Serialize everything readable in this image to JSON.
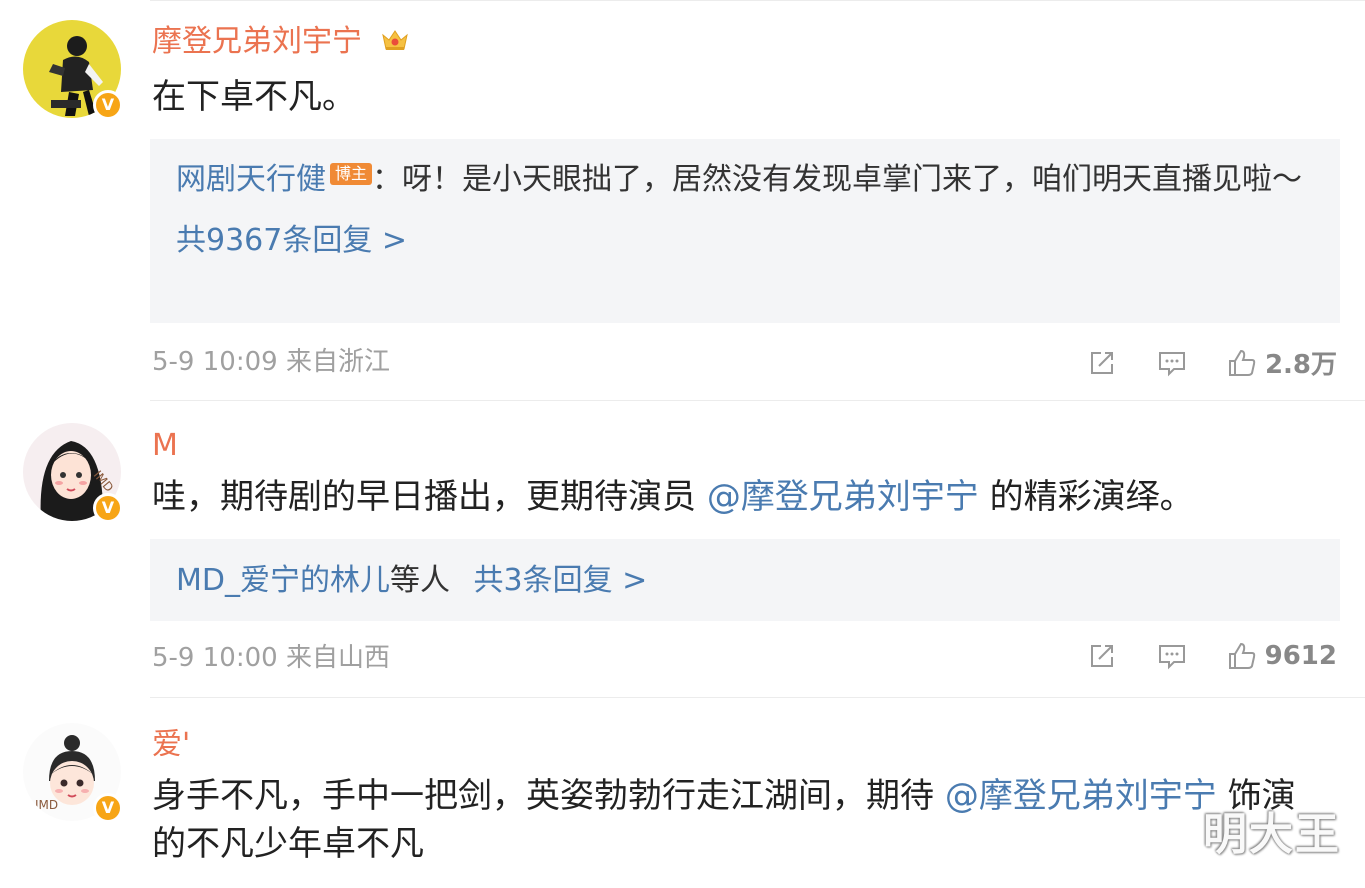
{
  "comments": [
    {
      "username": "摩登兄弟刘宇宁",
      "content": "在下卓不凡。",
      "reply": {
        "name": "网剧天行健",
        "tag": "博主",
        "text": "：呀！是小天眼拙了，居然没有发现卓掌门来了，咱们明天直播见啦～",
        "link": "共9367条回复 >"
      },
      "time": "5-9 10:09",
      "source": "来自浙江",
      "likes": "2.8万"
    },
    {
      "username": "M",
      "content_prefix": "哇，期待剧的早日播出，更期待演员 ",
      "mention": "@摩登兄弟刘宇宁",
      "content_suffix": " 的精彩演绎。",
      "reply": {
        "name": "MD_爱宁的林儿",
        "others": "等人",
        "link": "共3条回复 >"
      },
      "time": "5-9 10:00",
      "source": "来自山西",
      "likes": "9612"
    },
    {
      "username": "爱'",
      "content_prefix": "身手不凡，手中一把剑，英姿勃勃行走江湖间，期待 ",
      "mention": "@摩登兄弟刘宇宁",
      "content_suffix": " 饰演的不凡少年卓不凡"
    }
  ],
  "watermark": "明大王",
  "colors": {
    "username": "#eb7350",
    "link": "#4a7bb0",
    "badge": "#f7a516",
    "reply_bg": "#f4f5f7"
  },
  "icons": [
    "crown-icon",
    "verified-badge-icon",
    "share-icon",
    "comment-icon",
    "like-icon"
  ]
}
